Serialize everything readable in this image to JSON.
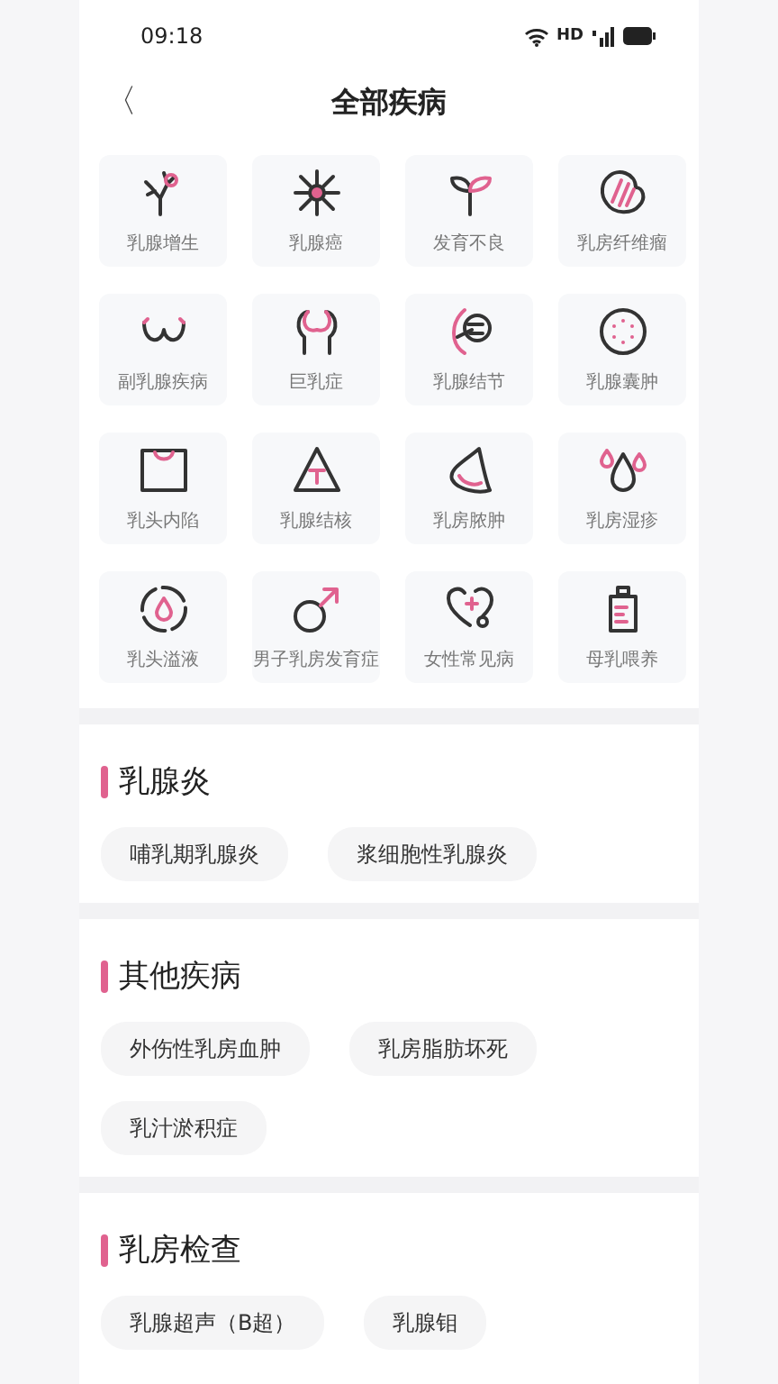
{
  "status_bar": {
    "time": "09:18",
    "network": "HD"
  },
  "header": {
    "back": "〈",
    "title": "全部疾病"
  },
  "diseases": [
    {
      "label": "乳腺增生"
    },
    {
      "label": "乳腺癌"
    },
    {
      "label": "发育不良"
    },
    {
      "label": "乳房纤维瘤"
    },
    {
      "label": "副乳腺疾病"
    },
    {
      "label": "巨乳症"
    },
    {
      "label": "乳腺结节"
    },
    {
      "label": "乳腺囊肿"
    },
    {
      "label": "乳头内陷"
    },
    {
      "label": "乳腺结核"
    },
    {
      "label": "乳房脓肿"
    },
    {
      "label": "乳房湿疹"
    },
    {
      "label": "乳头溢液"
    },
    {
      "label": "男子乳房发育症"
    },
    {
      "label": "女性常见病"
    },
    {
      "label": "母乳喂养"
    }
  ],
  "sections": [
    {
      "title": "乳腺炎",
      "chips": [
        "哺乳期乳腺炎",
        "浆细胞性乳腺炎"
      ]
    },
    {
      "title": "其他疾病",
      "chips": [
        "外伤性乳房血肿",
        "乳房脂肪坏死",
        "乳汁淤积症"
      ]
    },
    {
      "title": "乳房检查",
      "chips": [
        "乳腺超声（B超）",
        "乳腺钼"
      ]
    }
  ]
}
